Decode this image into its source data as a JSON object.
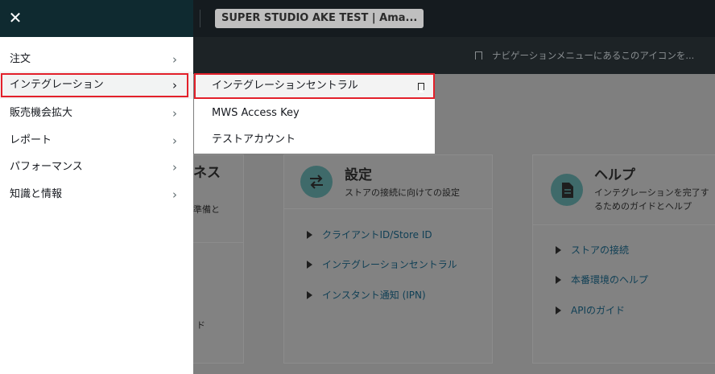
{
  "topbar": {
    "store_name": "SUPER STUDIO AKE TEST | Ama..."
  },
  "subbar": {
    "tip": "ナビゲーションメニューにあるこのアイコンを..."
  },
  "drawer": {
    "items": [
      {
        "label": "注文"
      },
      {
        "label": "インテグレーション"
      },
      {
        "label": "販売機会拡大"
      },
      {
        "label": "レポート"
      },
      {
        "label": "パフォーマンス"
      },
      {
        "label": "知識と情報"
      }
    ]
  },
  "submenu": {
    "items": [
      {
        "label": "インテグレーションセントラル"
      },
      {
        "label": "MWS Access Key"
      },
      {
        "label": "テストアカウント"
      }
    ]
  },
  "cards": {
    "left": {
      "title_frag": "ネス",
      "sub_frag": "準備と",
      "link_frag": "ド"
    },
    "settings": {
      "title": "設定",
      "subtitle": "ストアの接続に向けての設定",
      "links": [
        "クライアントID/Store ID",
        "インテグレーションセントラル",
        "インスタント通知 (IPN)"
      ]
    },
    "help": {
      "title": "ヘルプ",
      "subtitle_1": "インテグレーションを完了す",
      "subtitle_2": "るためのガイドとヘルプ",
      "links": [
        "ストアの接続",
        "本番環境のヘルプ",
        "APIのガイド"
      ]
    }
  },
  "colors": {
    "highlight": "#e3202a",
    "drawer_header": "#0f2a30"
  }
}
